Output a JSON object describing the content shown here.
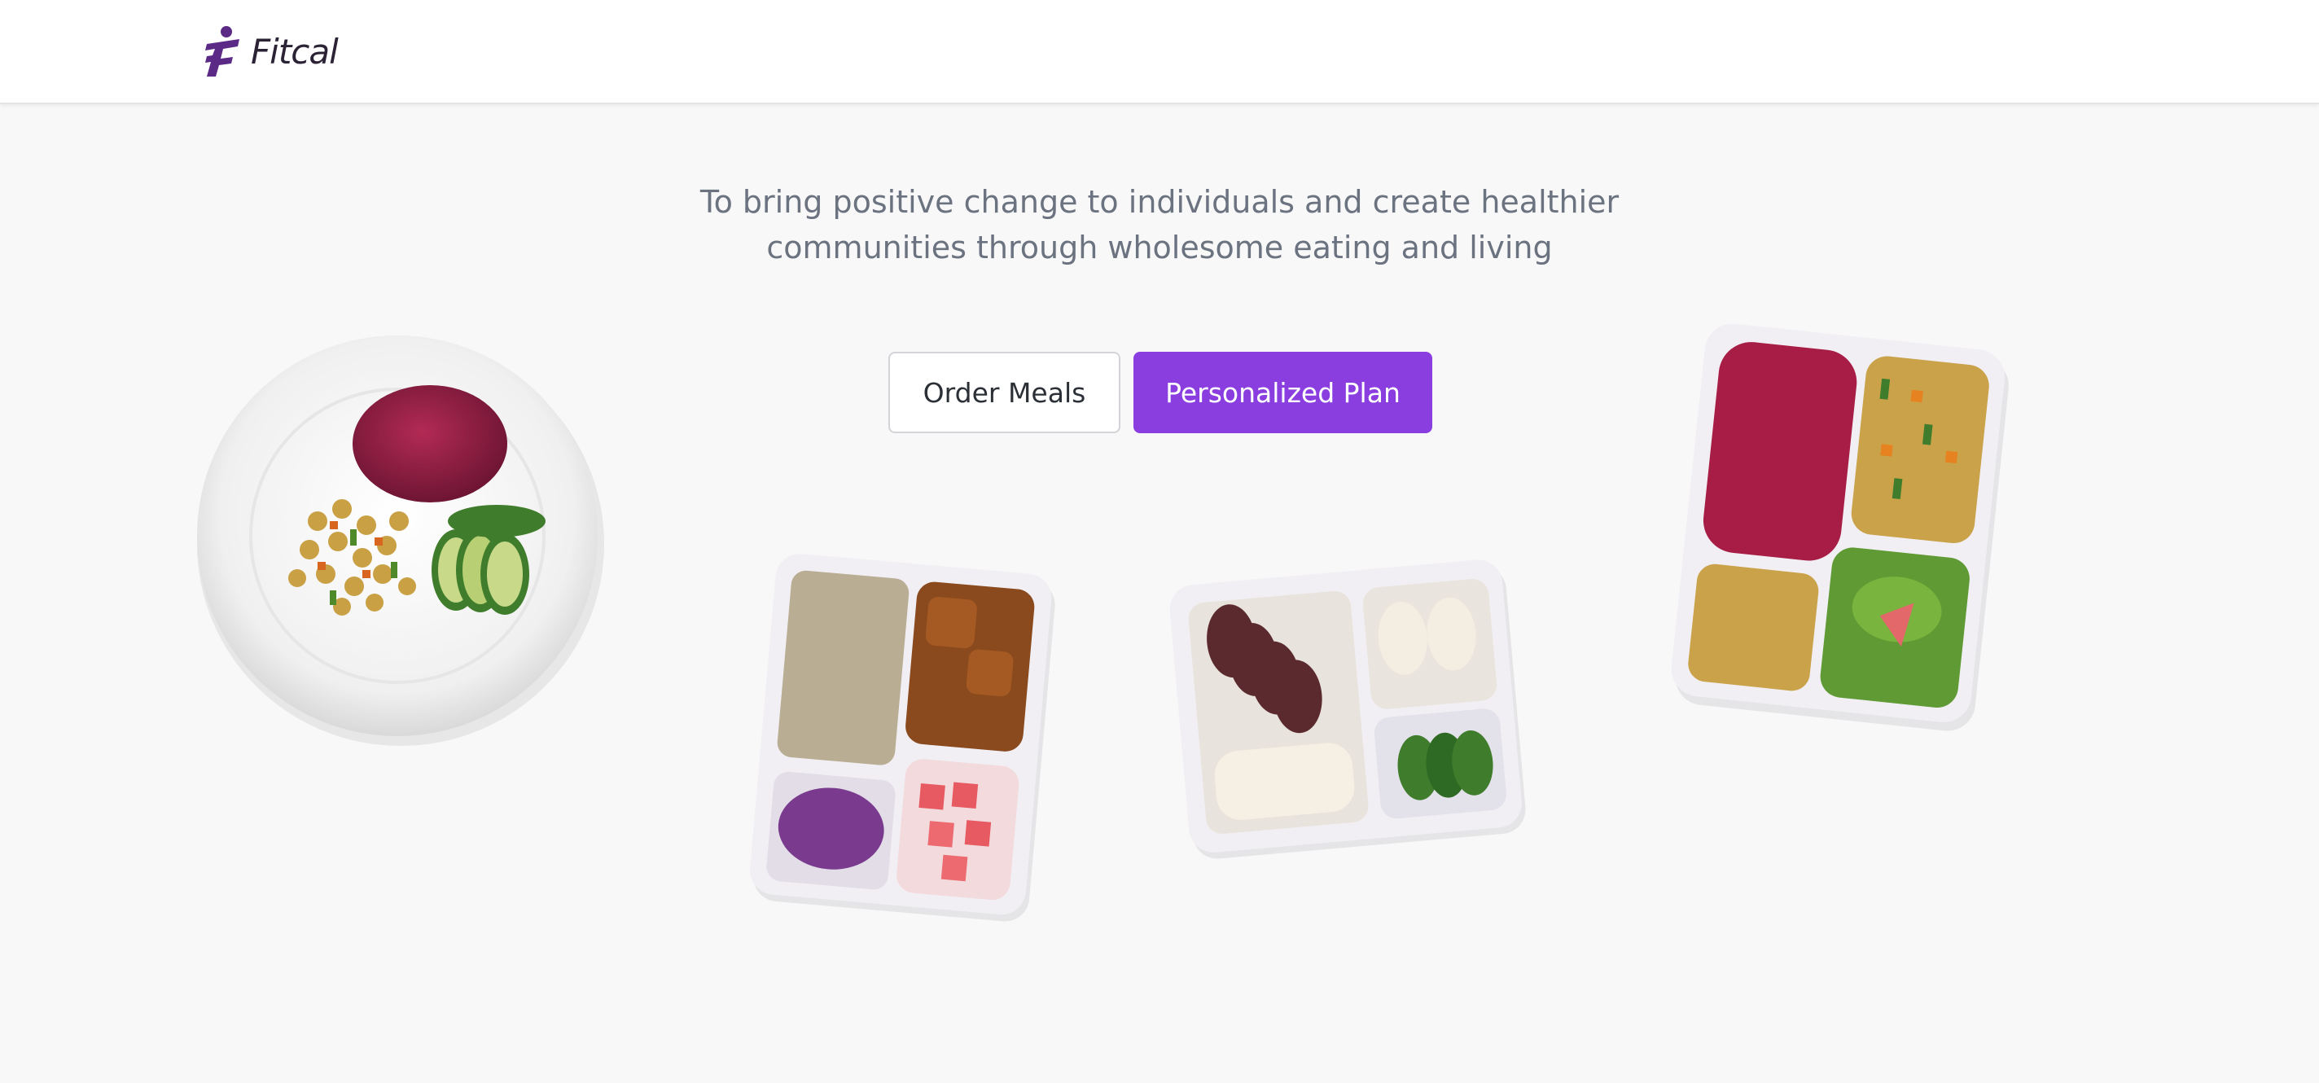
{
  "brand": {
    "name": "Fitcal",
    "accent": "#8a3ee0",
    "logo_color": "#5b2a86"
  },
  "hero": {
    "tagline_line1": "To bring positive change to individuals and create healthier",
    "tagline_line2": "communities through wholesome eating and living"
  },
  "actions": {
    "order_label": "Order Meals",
    "plan_label": "Personalized Plan"
  },
  "images": [
    {
      "name": "plate-beet-rice-chickpeas-zucchini"
    },
    {
      "name": "tray-rice-curry-cabbage-watermelon"
    },
    {
      "name": "tray-beef-chicken-zucchini"
    },
    {
      "name": "tray-beet-rice-chickpeas-salad"
    }
  ]
}
